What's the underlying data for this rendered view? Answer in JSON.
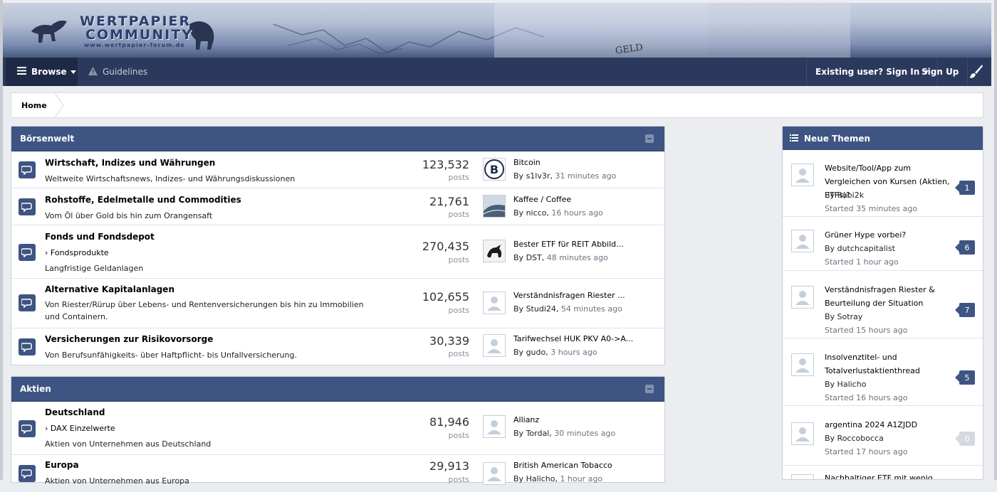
{
  "site": {
    "logo_line1": "WERTPAPIER",
    "logo_line2": "COMMUNITY",
    "logo_url_text": "www.wertpapier-forum.de",
    "banner_word": "GELD"
  },
  "nav": {
    "browse": "Browse",
    "guidelines": "Guidelines",
    "signin": "Existing user? Sign In",
    "signup": "Sign Up",
    "icons": [
      "list-icon",
      "warning-icon",
      "brush-icon"
    ]
  },
  "breadcrumb": {
    "home": "Home"
  },
  "colors": {
    "header_blue": "#3e5482",
    "nav_dark": "#2b3a5c",
    "page_bg": "#ebedf0"
  },
  "sections": [
    {
      "title": "Börsenwelt",
      "forums": [
        {
          "title": "Wirtschaft, Indizes und Währungen",
          "desc": "Weltweite Wirtschaftsnews, Indizes- und Währungsdiskussionen",
          "count": "123,532",
          "posts": "posts",
          "last_title": "Bitcoin",
          "by": "By ",
          "user": "s1lv3r",
          "time": "31 minutes ago"
        },
        {
          "title": "Rohstoffe, Edelmetalle und Commodities",
          "desc": "Vom Öl über Gold bis hin zum Orangensaft",
          "count": "21,761",
          "posts": "posts",
          "last_title": "Kaffee / Coffee",
          "by": "By ",
          "user": "nicco",
          "time": "16 hours ago"
        },
        {
          "title": "Fonds und Fondsdepot",
          "sub": "Fondsprodukte",
          "desc": "Langfristige Geldanlagen",
          "count": "270,435",
          "posts": "posts",
          "last_title": "Bester ETF für REIT Abbild...",
          "by": "By ",
          "user": "DST",
          "time": "48 minutes ago"
        },
        {
          "title": "Alternative Kapitalanlagen",
          "desc": "Von Riester/Rürup über Lebens- und Rentenversicherungen bis hin zu Immobilien und Containern.",
          "count": "102,655",
          "posts": "posts",
          "last_title": "Verständnisfragen Riester ...",
          "by": "By ",
          "user": "Studi24",
          "time": "54 minutes ago"
        },
        {
          "title": "Versicherungen zur Risikovorsorge",
          "desc": "Von Berufsunfähigkeits- über Haftpflicht- bis Unfallversicherung.",
          "count": "30,339",
          "posts": "posts",
          "last_title": "Tarifwechsel HUK PKV A0->A...",
          "by": "By ",
          "user": "gudo",
          "time": "3 hours ago"
        }
      ]
    },
    {
      "title": "Aktien",
      "forums": [
        {
          "title": "Deutschland",
          "sub": "DAX Einzelwerte",
          "desc": "Aktien von Unternehmen aus Deutschland",
          "count": "81,946",
          "posts": "posts",
          "last_title": "Allianz",
          "by": "By ",
          "user": "Tordal",
          "time": "30 minutes ago"
        },
        {
          "title": "Europa",
          "desc": "Aktien von Unternehmen aus Europa",
          "count": "29,913",
          "posts": "posts",
          "last_title": "British American Tobacco",
          "by": "By ",
          "user": "Halicho",
          "time": "1 hour ago"
        }
      ]
    }
  ],
  "sidebar": {
    "title": "Neue Themen",
    "items": [
      {
        "title": "Website/Tool/App zum Vergleichen von Kursen (Aktien, ETFs)?",
        "by": "By Rubi2k",
        "started": "Started 35 minutes ago",
        "replies": "1"
      },
      {
        "title": "Grüner Hype vorbei?",
        "by": "By dutchcapitalist",
        "started": "Started 1 hour ago",
        "replies": "6"
      },
      {
        "title": "Verständnisfragen Riester & Beurteilung der Situation",
        "by": "By Sotray",
        "started": "Started 15 hours ago",
        "replies": "7"
      },
      {
        "title": "Insolvenztitel- und Totalverlustaktienthread",
        "by": "By Halicho",
        "started": "Started 16 hours ago",
        "replies": "5"
      },
      {
        "title": "argentina 2024 A1ZJDD",
        "by": "By Roccobocca",
        "started": "Started 17 hours ago",
        "replies": "0"
      },
      {
        "title": "Nachhaltiger ETF mit wenig",
        "by": "",
        "started": "",
        "replies": ""
      }
    ]
  }
}
